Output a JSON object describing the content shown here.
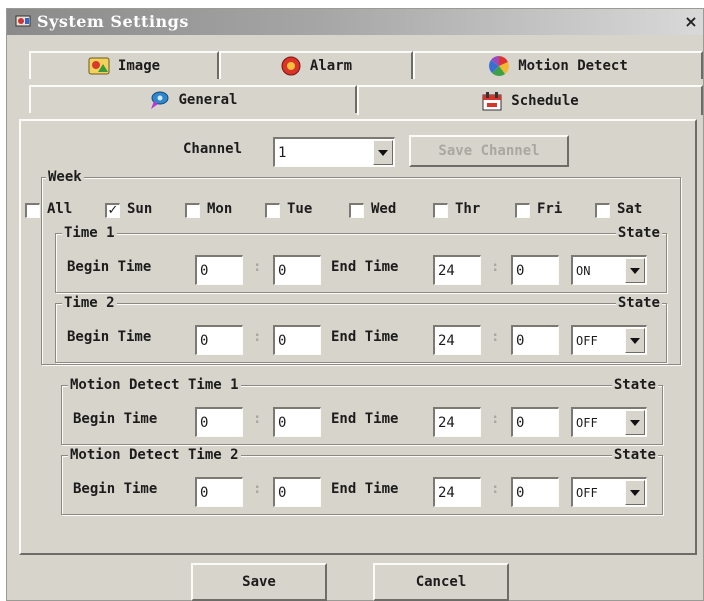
{
  "window": {
    "title": "System Settings",
    "close_glyph": "×"
  },
  "tabs": {
    "row1": [
      {
        "label": "Image",
        "icon": "image-icon"
      },
      {
        "label": "Alarm",
        "icon": "alarm-icon"
      },
      {
        "label": "Motion Detect",
        "icon": "motion-detect-icon"
      }
    ],
    "row2": [
      {
        "label": "General",
        "icon": "general-icon"
      },
      {
        "label": "Schedule",
        "icon": "schedule-icon",
        "active": true
      }
    ]
  },
  "channel": {
    "label": "Channel",
    "value": "1",
    "save_channel": "Save Channel"
  },
  "week": {
    "title": "Week",
    "days": [
      {
        "label": "All",
        "checked": false
      },
      {
        "label": "Sun",
        "checked": true
      },
      {
        "label": "Mon",
        "checked": false
      },
      {
        "label": "Tue",
        "checked": false
      },
      {
        "label": "Wed",
        "checked": false
      },
      {
        "label": "Thr",
        "checked": false
      },
      {
        "label": "Fri",
        "checked": false
      },
      {
        "label": "Sat",
        "checked": false
      }
    ]
  },
  "labels": {
    "begin": "Begin Time",
    "end": "End Time",
    "state": "State",
    "colon": ":"
  },
  "schedules": [
    {
      "title": "Time 1",
      "begin_h": "0",
      "begin_m": "0",
      "end_h": "24",
      "end_m": "0",
      "state": "ON"
    },
    {
      "title": "Time 2",
      "begin_h": "0",
      "begin_m": "0",
      "end_h": "24",
      "end_m": "0",
      "state": "OFF"
    },
    {
      "title": "Motion Detect Time 1",
      "begin_h": "0",
      "begin_m": "0",
      "end_h": "24",
      "end_m": "0",
      "state": "OFF"
    },
    {
      "title": "Motion Detect Time 2",
      "begin_h": "0",
      "begin_m": "0",
      "end_h": "24",
      "end_m": "0",
      "state": "OFF"
    }
  ],
  "buttons": {
    "save": "Save",
    "cancel": "Cancel"
  },
  "colors": {
    "face": "#d7d4cc",
    "highlight": "#fbfbf8",
    "shadow": "#6e6c66",
    "title_gradient_start": "#8a8a8a"
  }
}
